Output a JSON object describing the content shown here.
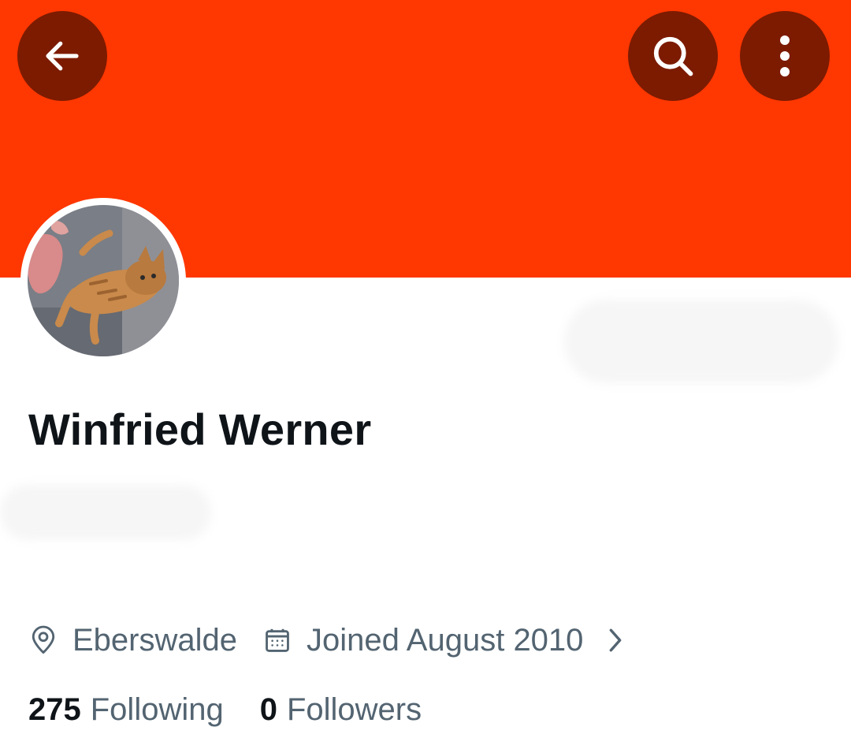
{
  "header": {
    "banner_color": "#ff3700",
    "button_color": "#7c1b00",
    "back_icon": "arrow-left-icon",
    "search_icon": "search-icon",
    "more_icon": "more-vertical-icon"
  },
  "profile": {
    "display_name": "Winfried Werner",
    "avatar_icon": "cat-photo-avatar",
    "location": "Eberswalde",
    "location_icon": "location-pin-icon",
    "joined": "Joined August 2010",
    "joined_icon": "calendar-icon",
    "expand_icon": "chevron-right-icon"
  },
  "stats": {
    "following_count": "275",
    "following_label": "Following",
    "followers_count": "0",
    "followers_label": "Followers"
  }
}
